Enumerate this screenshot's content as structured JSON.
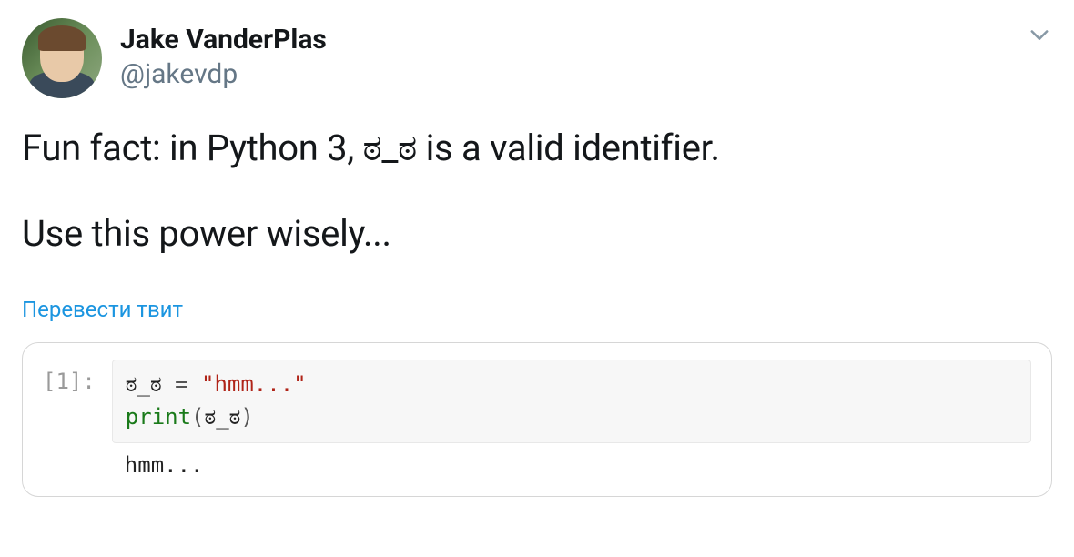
{
  "author": {
    "display_name": "Jake VanderPlas",
    "handle": "@jakevdp"
  },
  "tweet": {
    "line1": "Fun fact: in Python 3, ಠ_ಠ is a valid identifier.",
    "line2": "Use this power wisely..."
  },
  "translate_label": "Перевести твит",
  "code": {
    "prompt": "[1]:",
    "line1": {
      "identifier": "ಠ_ಠ",
      "op": " = ",
      "string": "\"hmm...\""
    },
    "line2": {
      "fn": "print",
      "open": "(",
      "arg": "ಠ_ಠ",
      "close": ")"
    },
    "output": "hmm..."
  }
}
